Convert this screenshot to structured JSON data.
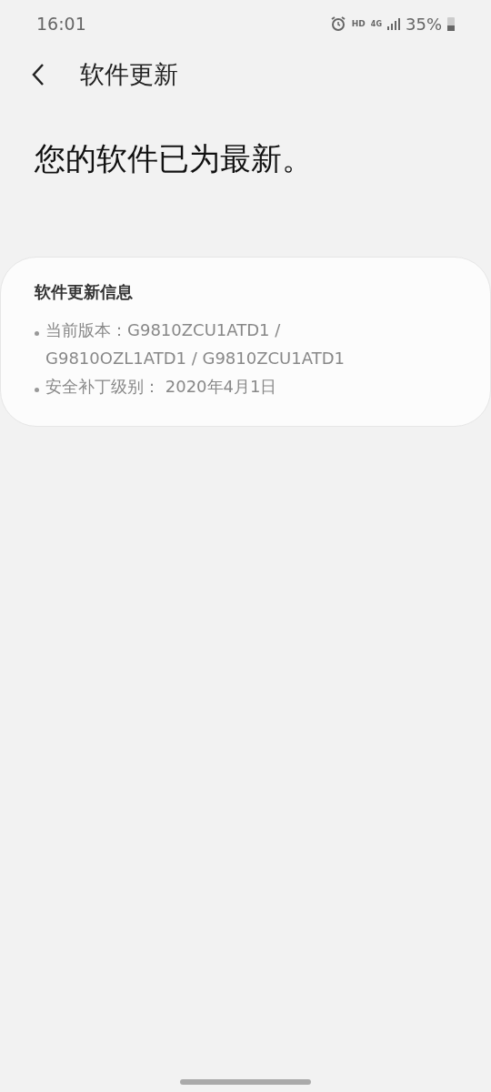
{
  "status_bar": {
    "time": "16:01",
    "network_label": "HD",
    "network_type": "4G",
    "battery": "35%"
  },
  "app_bar": {
    "title": "软件更新"
  },
  "headline": "您的软件已为最新。",
  "info_card": {
    "title": "软件更新信息",
    "items": [
      {
        "text": "当前版本：G9810ZCU1ATD1 / G9810OZL1ATD1 / G9810ZCU1ATD1"
      },
      {
        "text": "安全补丁级别： 2020年4月1日"
      }
    ]
  }
}
